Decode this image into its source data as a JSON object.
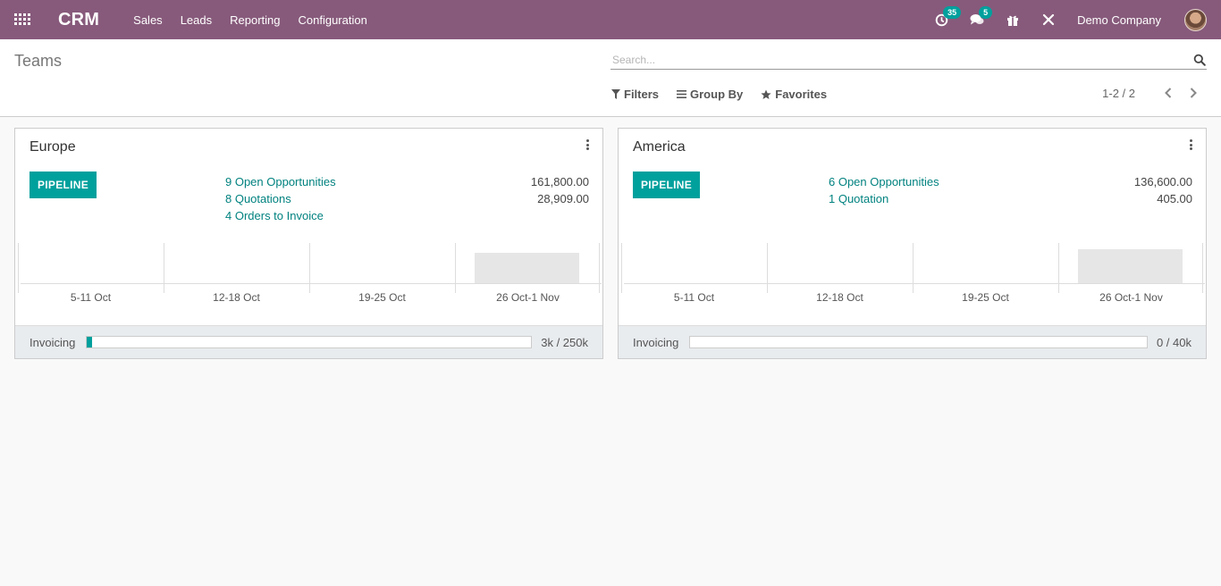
{
  "app": {
    "brand": "CRM",
    "menu": [
      {
        "label": "Sales"
      },
      {
        "label": "Leads"
      },
      {
        "label": "Reporting"
      },
      {
        "label": "Configuration"
      }
    ],
    "activities_badge": "35",
    "messages_badge": "5",
    "company": "Demo Company"
  },
  "control_panel": {
    "title": "Teams",
    "search_placeholder": "Search...",
    "filters_label": "Filters",
    "groupby_label": "Group By",
    "favorites_label": "Favorites",
    "pager": "1-2 / 2"
  },
  "teams": [
    {
      "name": "Europe",
      "pipeline_label": "PIPELINE",
      "stats": [
        {
          "label": "9 Open Opportunities",
          "value": "161,800.00"
        },
        {
          "label": "8 Quotations",
          "value": "28,909.00"
        },
        {
          "label": "4 Orders to Invoice",
          "value": ""
        }
      ],
      "graph": {
        "weeks": [
          "5-11 Oct",
          "12-18 Oct",
          "19-25 Oct",
          "26 Oct-1 Nov"
        ],
        "bar_levels": [
          0,
          0,
          0,
          0.75
        ]
      },
      "footer": {
        "label": "Invoicing",
        "progress_fraction": 0.012,
        "value": "3k / 250k"
      }
    },
    {
      "name": "America",
      "pipeline_label": "PIPELINE",
      "stats": [
        {
          "label": "6 Open Opportunities",
          "value": "136,600.00"
        },
        {
          "label": "1 Quotation",
          "value": "405.00"
        }
      ],
      "graph": {
        "weeks": [
          "5-11 Oct",
          "12-18 Oct",
          "19-25 Oct",
          "26 Oct-1 Nov"
        ],
        "bar_levels": [
          0,
          0,
          0,
          0.85
        ]
      },
      "footer": {
        "label": "Invoicing",
        "progress_fraction": 0,
        "value": "0 / 40k"
      }
    }
  ],
  "colors": {
    "navbar": "#875a7b",
    "accent": "#00a09d",
    "link": "#00827f"
  }
}
